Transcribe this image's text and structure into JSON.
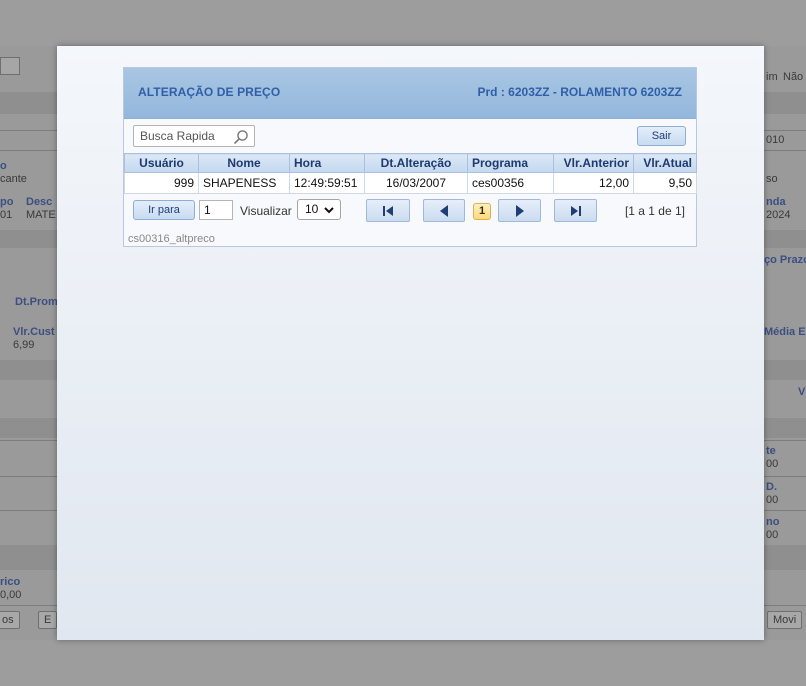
{
  "background": {
    "fragments": [
      {
        "id": "frag-1",
        "text": "o",
        "blue": true
      },
      {
        "id": "frag-2",
        "text": "cante",
        "blue": false
      },
      {
        "id": "frag-3",
        "text": "po",
        "blue": true
      },
      {
        "id": "frag-4",
        "text": "Desc",
        "blue": true
      },
      {
        "id": "frag-5",
        "text": "01",
        "blue": false
      },
      {
        "id": "frag-6",
        "text": "MATE",
        "blue": false
      },
      {
        "id": "frag-7",
        "text": "Dt.Prom",
        "blue": true
      },
      {
        "id": "frag-8",
        "text": "Vlr.Cust",
        "blue": true
      },
      {
        "id": "frag-9",
        "text": "6,99",
        "blue": false
      },
      {
        "id": "frag-10",
        "text": "rico",
        "blue": true
      },
      {
        "id": "frag-11",
        "text": "0,00",
        "blue": false
      },
      {
        "id": "frag-12",
        "text": "im",
        "blue": false
      },
      {
        "id": "frag-13",
        "text": "Não",
        "blue": false
      },
      {
        "id": "frag-14",
        "text": "010",
        "blue": false
      },
      {
        "id": "frag-15",
        "text": "so",
        "blue": false
      },
      {
        "id": "frag-16",
        "text": "nda",
        "blue": true
      },
      {
        "id": "frag-17",
        "text": "2024",
        "blue": false
      },
      {
        "id": "frag-18",
        "text": "ço Prazo",
        "blue": true
      },
      {
        "id": "frag-19",
        "text": "Média En",
        "blue": true
      },
      {
        "id": "frag-20",
        "text": "V",
        "blue": true
      },
      {
        "id": "frag-21",
        "text": "te",
        "blue": true
      },
      {
        "id": "frag-22",
        "text": "00",
        "blue": false
      },
      {
        "id": "frag-23",
        "text": "D.",
        "blue": true
      },
      {
        "id": "frag-24",
        "text": "00",
        "blue": false
      },
      {
        "id": "frag-25",
        "text": "no",
        "blue": true
      },
      {
        "id": "frag-26",
        "text": "00",
        "blue": false
      }
    ],
    "buttons": {
      "left_1": "os",
      "left_2": "E",
      "right_1": "Movi"
    }
  },
  "dialog": {
    "title": "ALTERAÇÃO DE PREÇO",
    "product": "Prd : 6203ZZ - ROLAMENTO 6203ZZ",
    "search": {
      "placeholder": "Busca Rapida",
      "value": ""
    },
    "close_label": "Sair",
    "table": {
      "columns": [
        "Usuário",
        "Nome",
        "Hora",
        "Dt.Alteração",
        "Programa",
        "Vlr.Anterior",
        "Vlr.Atual"
      ],
      "rows": [
        [
          "999",
          "SHAPENESS",
          "12:49:59:51",
          "16/03/2007",
          "ces00356",
          "12,00",
          "9,50"
        ]
      ]
    },
    "pager": {
      "goto_label": "Ir para",
      "goto_value": "1",
      "visualizar_label": "Visualizar",
      "page_size": "10",
      "current_page": "1",
      "range_text": "[1 a 1 de 1]"
    },
    "form_id": "cs00316_altpreco"
  },
  "colors": {
    "header_text": "#2f5fa8",
    "header_bg": "#93b7dc",
    "grid_header_bg": "#c4d8ef",
    "current_page_bg": "#fbd97e"
  },
  "icons": {
    "search": "magnifier-icon",
    "first": "first-page-icon",
    "prev": "prev-page-icon",
    "next": "next-page-icon",
    "last": "last-page-icon",
    "select_caret": "chevron-down-icon"
  }
}
